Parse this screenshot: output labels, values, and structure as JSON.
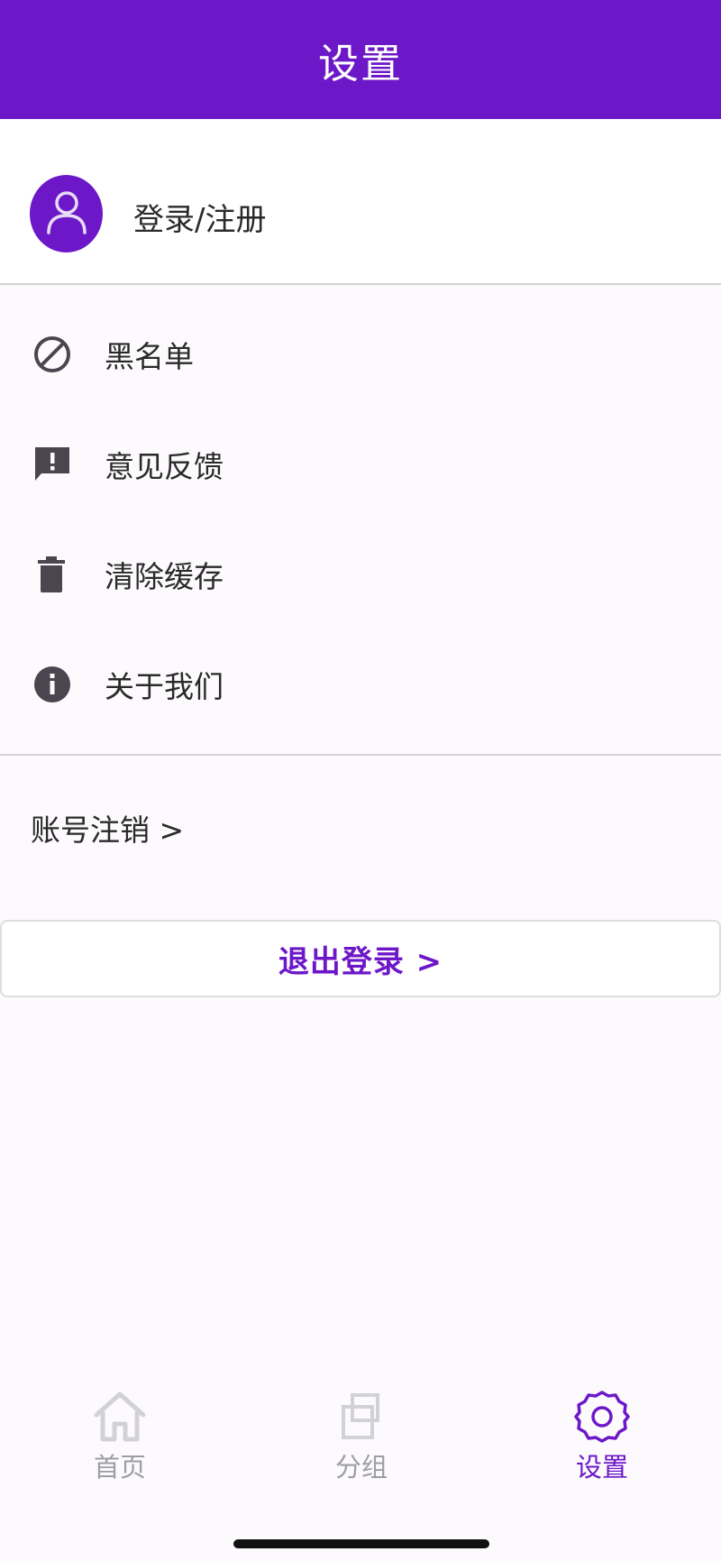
{
  "header": {
    "title": "设置"
  },
  "profile": {
    "label": "登录/注册",
    "avatar_icon": "user-icon"
  },
  "menu": {
    "items": [
      {
        "label": "黑名单",
        "icon": "block-icon"
      },
      {
        "label": "意见反馈",
        "icon": "feedback-icon"
      },
      {
        "label": "清除缓存",
        "icon": "trash-icon"
      },
      {
        "label": "关于我们",
        "icon": "info-icon"
      }
    ]
  },
  "account": {
    "deactivate_label": "账号注销 >"
  },
  "logout": {
    "label": "退出登录 >"
  },
  "tabs": [
    {
      "label": "首页",
      "icon": "home-icon",
      "active": false
    },
    {
      "label": "分组",
      "icon": "group-icon",
      "active": false
    },
    {
      "label": "设置",
      "icon": "gear-icon",
      "active": true
    }
  ],
  "colors": {
    "primary": "#6d18c8",
    "icon_dark": "#4a4650",
    "tab_inactive": "#9e9ea2"
  }
}
